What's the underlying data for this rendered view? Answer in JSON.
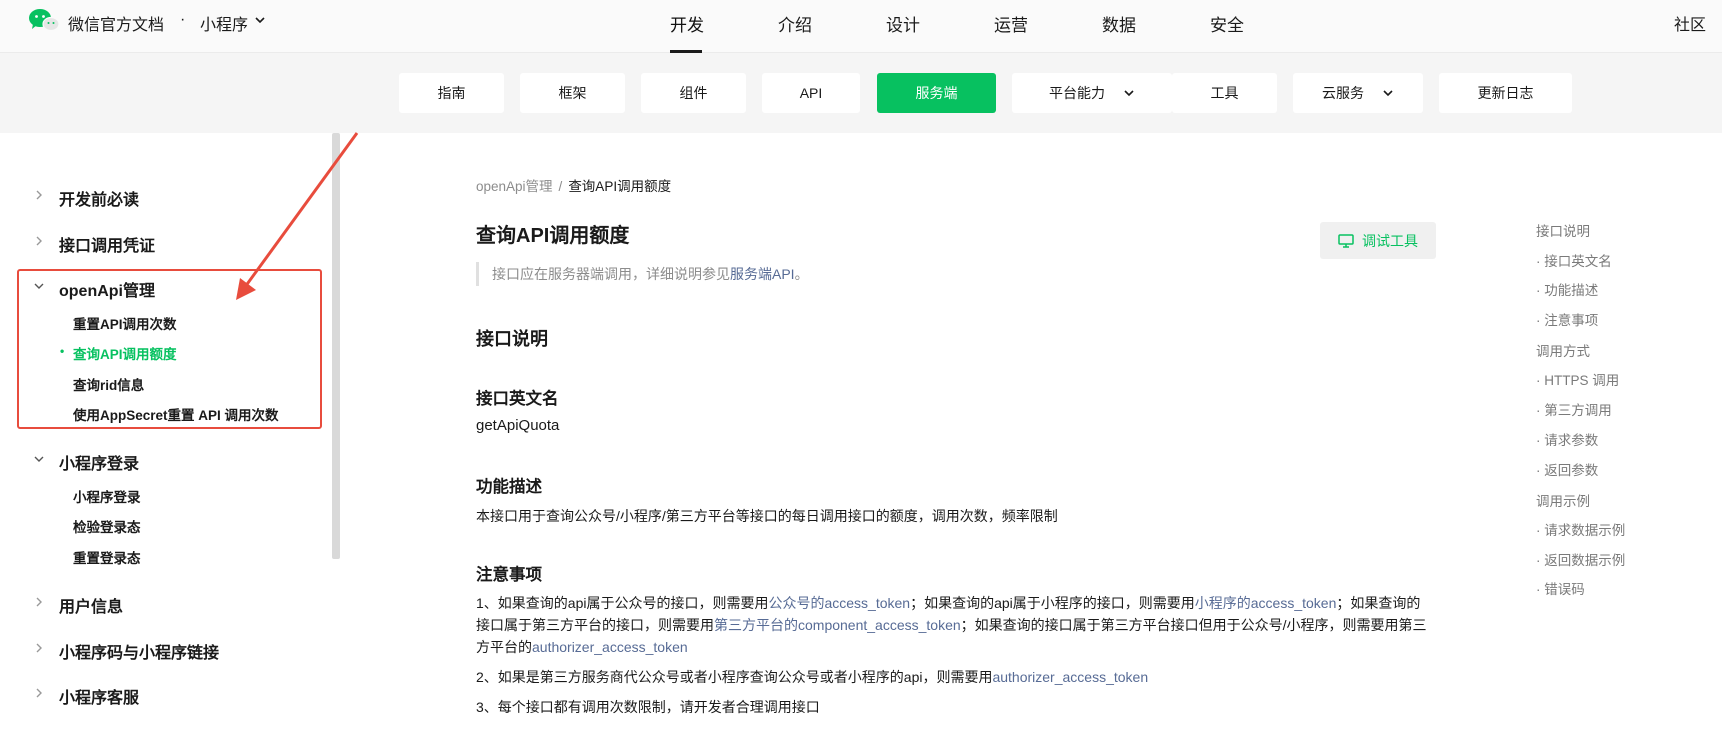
{
  "header": {
    "brand": "微信官方文档",
    "brand_sep": "·",
    "brand_sub": "小程序",
    "nav": [
      "开发",
      "介绍",
      "设计",
      "运营",
      "数据",
      "安全"
    ],
    "community": "社区"
  },
  "subnav": {
    "tabs": [
      "指南",
      "框架",
      "组件",
      "API",
      "服务端",
      "平台能力",
      "工具",
      "云服务",
      "更新日志"
    ],
    "active": "服务端"
  },
  "sidebar": {
    "groups": [
      {
        "label": "开发前必读"
      },
      {
        "label": "接口调用凭证"
      },
      {
        "label": "openApi管理",
        "items": [
          "重置API调用次数",
          "查询API调用额度",
          "查询rid信息",
          "使用AppSecret重置 API 调用次数"
        ]
      },
      {
        "label": "小程序登录",
        "items": [
          "小程序登录",
          "检验登录态",
          "重置登录态"
        ]
      },
      {
        "label": "用户信息"
      },
      {
        "label": "小程序码与小程序链接"
      },
      {
        "label": "小程序客服"
      }
    ],
    "active_item_dot": "•"
  },
  "main": {
    "breadcrumb": [
      "openApi管理",
      "查询API调用额度"
    ],
    "breadcrumb_sep": "/",
    "title": "查询API调用额度",
    "debug_button": "调试工具",
    "quote_prefix": "接口应在服务器端调用，详细说明参见",
    "quote_link": "服务端API",
    "quote_suffix": "。",
    "section_interface": "接口说明",
    "section_en_name": "接口英文名",
    "en_name": "getApiQuota",
    "section_function": "功能描述",
    "function_desc": "本接口用于查询公众号/小程序/第三方平台等接口的每日调用接口的额度，调用次数，频率限制",
    "section_notes": "注意事项",
    "note1": {
      "t1": "1、如果查询的api属于公众号的接口，则需要用",
      "l1": "公众号的access_token",
      "t2": "；如果查询的api属于小程序的接口，则需要用",
      "l2": "小程序的access_token",
      "t3": "；如果查询的接口属于第三方平台的接口，则需要用",
      "l3": "第三方平台的component_access_token",
      "t4": "；如果查询的接口属于第三方平台接口但用于公众号/小程序，则需要用第三方平台的",
      "l4": "authorizer_access_token"
    },
    "note2": {
      "t1": "2、如果是第三方服务商代公众号或者小程序查询公众号或者小程序的api，则需要用",
      "l1": "authorizer_access_token"
    },
    "note3": "3、每个接口都有调用次数限制，请开发者合理调用接口"
  },
  "toc": [
    {
      "label": "接口说明",
      "level": 1
    },
    {
      "label": "· 接口英文名",
      "level": 2
    },
    {
      "label": "· 功能描述",
      "level": 2
    },
    {
      "label": "· 注意事项",
      "level": 2
    },
    {
      "label": "调用方式",
      "level": 1
    },
    {
      "label": "· HTTPS 调用",
      "level": 2
    },
    {
      "label": "· 第三方调用",
      "level": 2
    },
    {
      "label": "· 请求参数",
      "level": 2
    },
    {
      "label": "· 返回参数",
      "level": 2
    },
    {
      "label": "调用示例",
      "level": 1
    },
    {
      "label": "· 请求数据示例",
      "level": 2
    },
    {
      "label": "· 返回数据示例",
      "level": 2
    },
    {
      "label": "· 错误码",
      "level": 2
    }
  ],
  "colors": {
    "accent_green": "#07c160",
    "link_blue": "#576b95",
    "annotation_red": "#e84c3d"
  },
  "icons": [
    "wechat-logo-icon",
    "chevron-down-icon",
    "chevron-right-icon",
    "monitor-icon"
  ]
}
